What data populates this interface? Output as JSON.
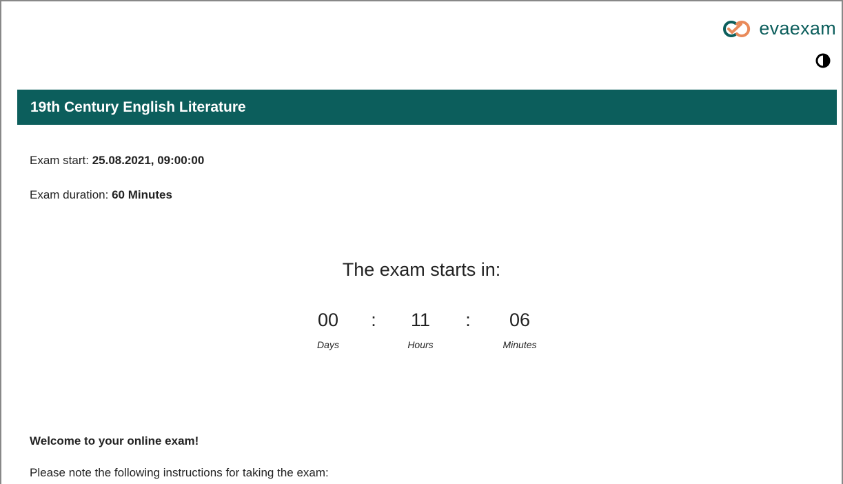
{
  "brand": {
    "name": "evaexam",
    "logo_icon": "evaexam-logo-icon",
    "primary_color": "#0c5e5c",
    "accent_color": "#e98a5a"
  },
  "contrast_toggle": {
    "icon": "contrast-icon"
  },
  "exam": {
    "title": "19th Century English Literature",
    "start_label": "Exam start:",
    "start_value": "25.08.2021, 09:00:00",
    "duration_label": "Exam duration:",
    "duration_value": "60 Minutes"
  },
  "countdown": {
    "heading": "The exam starts in:",
    "days": "00",
    "days_label": "Days",
    "hours": "11",
    "hours_label": "Hours",
    "minutes": "06",
    "minutes_label": "Minutes",
    "separator": ":"
  },
  "instructions": {
    "welcome": "Welcome to your online exam!",
    "note": "Please note the following instructions for taking the exam:"
  }
}
